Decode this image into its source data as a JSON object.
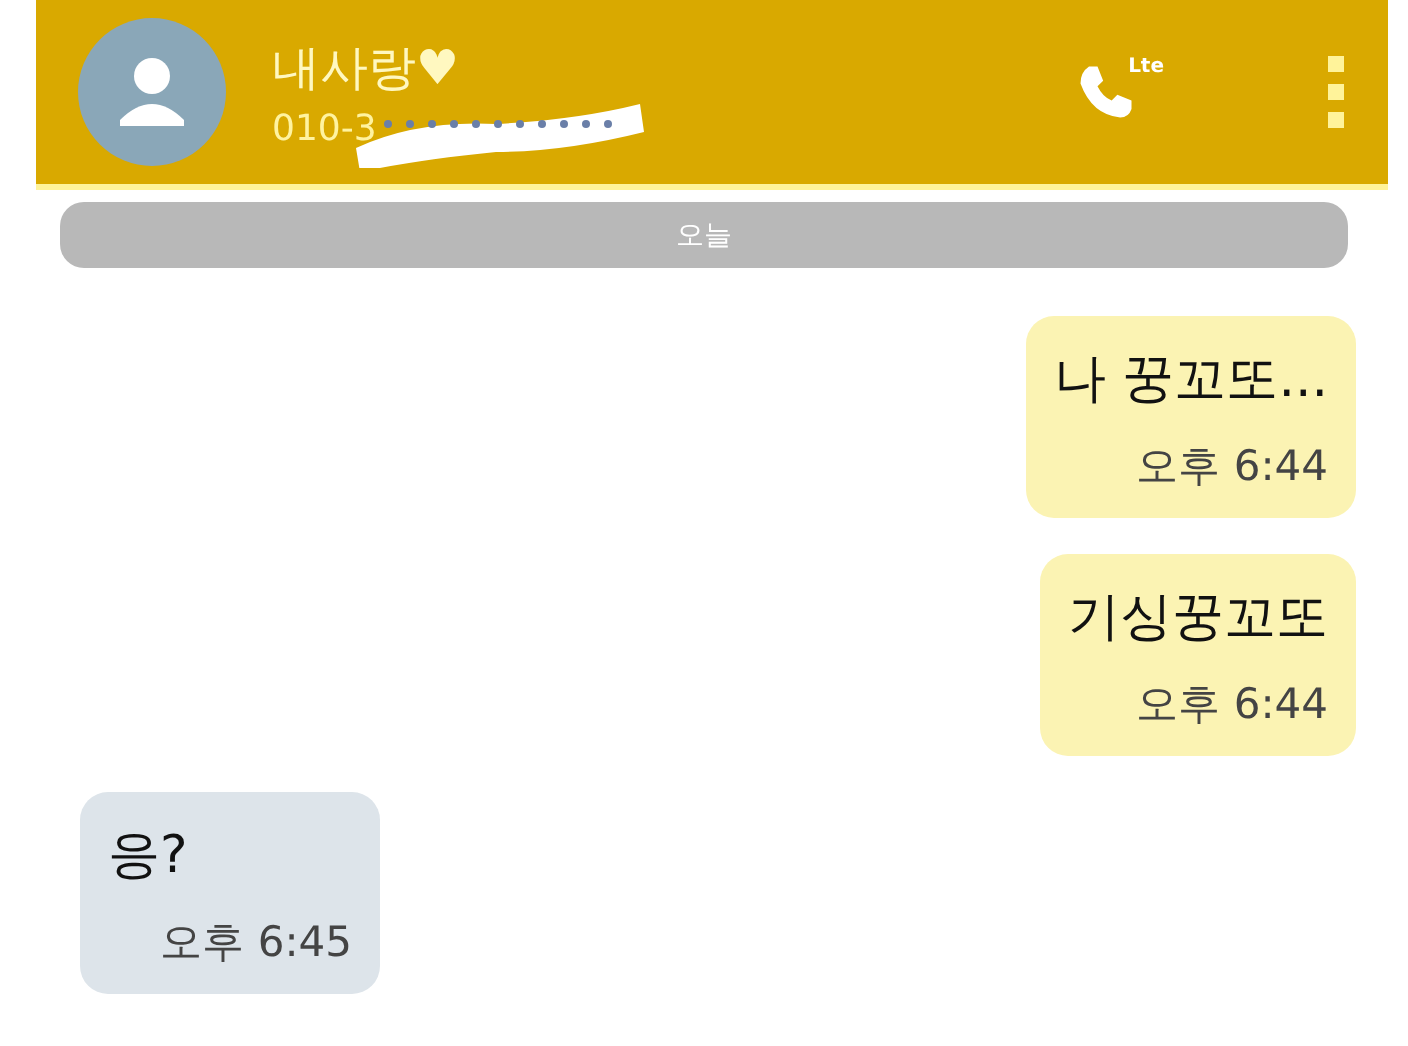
{
  "header": {
    "name": "내사랑♥",
    "phone": "010-3",
    "call_label": "Lte",
    "redacted": true
  },
  "date_divider": "오늘",
  "messages": [
    {
      "kind": "sent",
      "text": "나 꿍꼬또...",
      "time": "오후 6:44"
    },
    {
      "kind": "sent",
      "text": "기싱꿍꼬또",
      "time": "오후 6:44"
    },
    {
      "kind": "received",
      "text": "응?",
      "time": "오후 6:45"
    }
  ]
}
